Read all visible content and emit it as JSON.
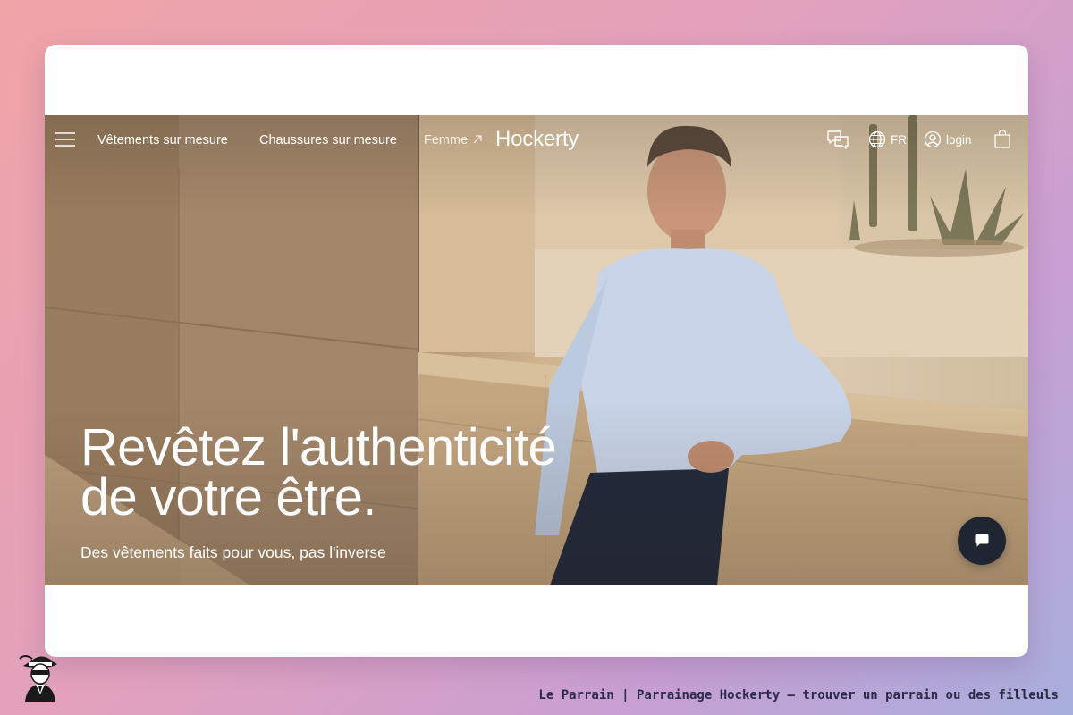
{
  "nav": {
    "menu_icon": "hamburger-menu-icon",
    "links": [
      {
        "label": "Vêtements sur mesure"
      },
      {
        "label": "Chaussures sur mesure"
      },
      {
        "label": "Femme",
        "icon": "external-arrow-icon"
      }
    ],
    "logo": "Hockerty",
    "chat_icon": "chat-bubbles-icon",
    "language_icon": "globe-icon",
    "language": "FR",
    "account_icon": "user-icon",
    "login": "login",
    "cart_icon": "shopping-bag-icon"
  },
  "hero": {
    "headline_line1": "Revêtez l'authenticité",
    "headline_line2": "de votre être.",
    "subheadline": "Des vêtements faits pour vous, pas l'inverse",
    "image": "man-in-light-blue-shirt-leaning-on-stone-wall-photo"
  },
  "chat_widget": {
    "icon": "chat-icon"
  },
  "footer": {
    "mascot": "godfather-mascot-logo",
    "caption": "Le Parrain | Parrainage Hockerty — trouver un parrain ou des filleuls"
  },
  "colors": {
    "page_gradient": [
      "#f0a4a6",
      "#e2a1bd",
      "#c79fd3",
      "#a7aedc"
    ],
    "card_background": "#ffffff",
    "nav_text": "#ffffff",
    "chat_button": "#1f2531",
    "caption_text": "#2c2a48"
  }
}
